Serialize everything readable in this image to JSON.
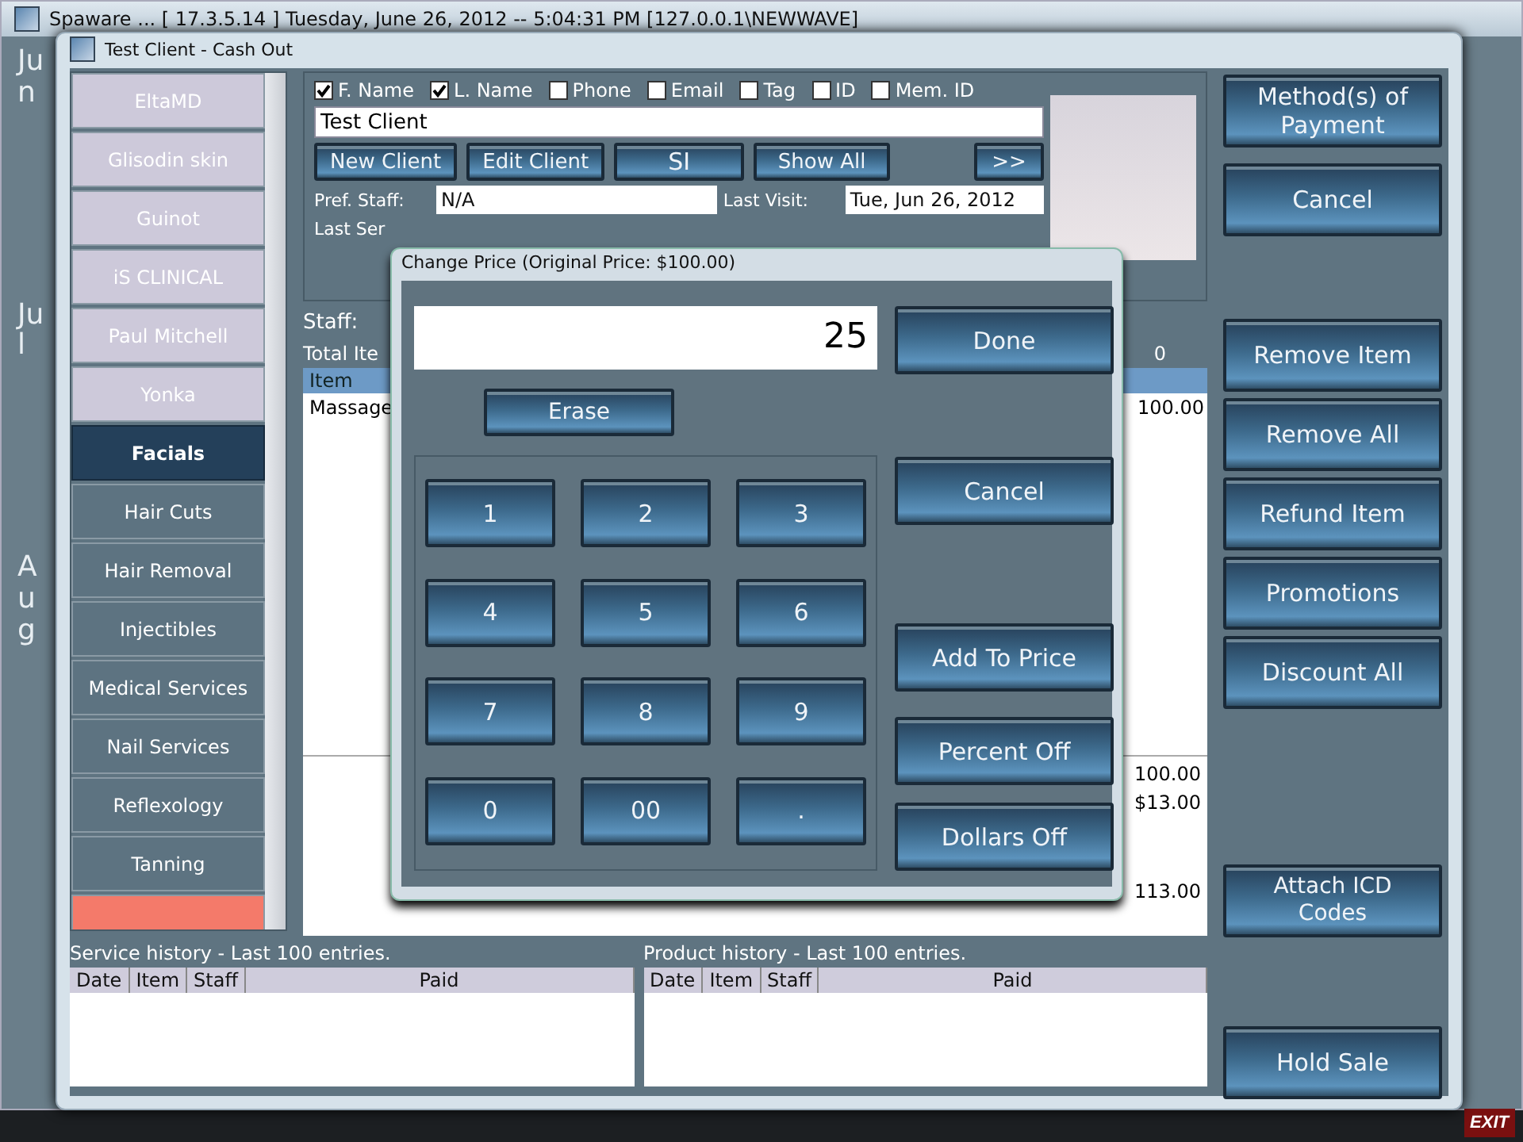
{
  "back_window": {
    "title": "Spaware ... [ 17.3.5.14 ] Tuesday, June 26, 2012 -- 5:04:31 PM [127.0.0.1\\NEWWAVE]",
    "months": [
      "Jun",
      "Jul",
      "Aug"
    ],
    "exit_label": "EXIT"
  },
  "window": {
    "title": "Test Client - Cash Out"
  },
  "categories": [
    {
      "label": "EltaMD",
      "selected": false,
      "color": "#cdc9da"
    },
    {
      "label": "Glisodin skin",
      "selected": false,
      "color": "#cdc9da"
    },
    {
      "label": "Guinot",
      "selected": false,
      "color": "#cdc9da"
    },
    {
      "label": "iS CLINICAL",
      "selected": false,
      "color": "#cdc9da"
    },
    {
      "label": "Paul Mitchell",
      "selected": false,
      "color": "#cdc9da"
    },
    {
      "label": "Yonka",
      "selected": false,
      "color": "#cdc9da"
    },
    {
      "label": "Facials",
      "selected": true,
      "color": "#24405a"
    },
    {
      "label": "Hair Cuts",
      "selected": false,
      "color": "#5d7381"
    },
    {
      "label": "Hair Removal",
      "selected": false,
      "color": "#5d7381"
    },
    {
      "label": "Injectibles",
      "selected": false,
      "color": "#5d7381"
    },
    {
      "label": "Medical Services",
      "selected": false,
      "color": "#5d7381"
    },
    {
      "label": "Nail Services",
      "selected": false,
      "color": "#5d7381"
    },
    {
      "label": "Reflexology",
      "selected": false,
      "color": "#5d7381"
    },
    {
      "label": "Tanning",
      "selected": false,
      "color": "#5d7381"
    },
    {
      "selected": false,
      "color": "#f47a6a"
    }
  ],
  "search_fields": [
    {
      "label": "F. Name",
      "checked": true
    },
    {
      "label": "L. Name",
      "checked": true
    },
    {
      "label": "Phone",
      "checked": false
    },
    {
      "label": "Email",
      "checked": false
    },
    {
      "label": "Tag",
      "checked": false
    },
    {
      "label": "ID",
      "checked": false
    },
    {
      "label": "Mem. ID",
      "checked": false
    }
  ],
  "client_name": "Test Client",
  "client_buttons": [
    "New Client",
    "Edit Client",
    "SI",
    "Show All",
    ">>"
  ],
  "client_info": {
    "pref_staff_label": "Pref. Staff:",
    "pref_staff": "N/A",
    "last_visit_label": "Last Visit:",
    "last_visit": "Tue, Jun 26, 2012",
    "last_service_label": "Last Ser"
  },
  "staff_label": "Staff:",
  "total_items_label": "Total Ite",
  "total_items_count": "0",
  "cart": {
    "header": "Item",
    "rows": [
      {
        "item": "Massage",
        "price": "100.00"
      }
    ],
    "totals": [
      "100.00",
      "$13.00",
      "113.00"
    ]
  },
  "right_buttons": [
    "Method(s) of Payment",
    "Cancel",
    "Remove Item",
    "Remove All",
    "Refund Item",
    "Promotions",
    "Discount All",
    "Attach ICD Codes",
    "Hold Sale"
  ],
  "history": [
    {
      "title": "Service history - Last 100 entries.",
      "columns": [
        "Date",
        "Item",
        "Staff",
        "Paid"
      ]
    },
    {
      "title": "Product history - Last 100 entries.",
      "columns": [
        "Date",
        "Item",
        "Staff",
        "Paid"
      ]
    }
  ],
  "dialog": {
    "title": "Change Price (Original Price: $100.00)",
    "value": "25",
    "erase": "Erase",
    "keys": [
      "1",
      "2",
      "3",
      "4",
      "5",
      "6",
      "7",
      "8",
      "9",
      "0",
      "00",
      "."
    ],
    "actions": [
      "Done",
      "Cancel",
      "Add To Price",
      "Percent Off",
      "Dollars Off"
    ]
  }
}
